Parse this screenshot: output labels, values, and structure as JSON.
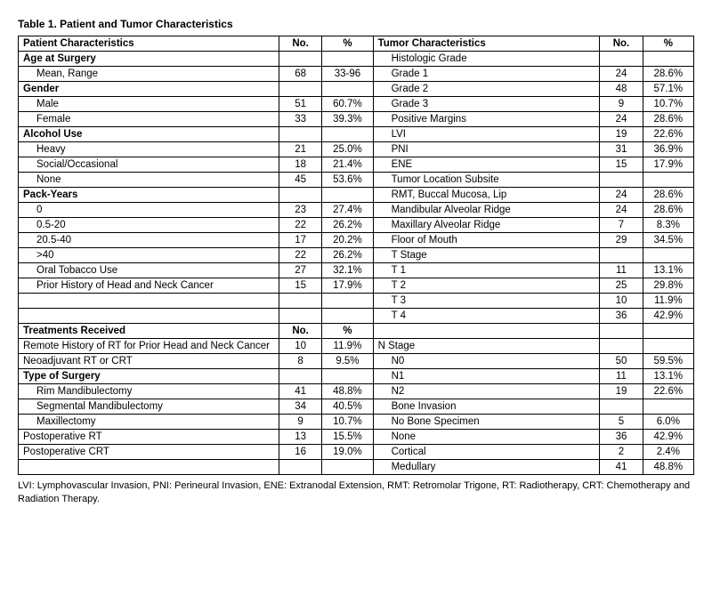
{
  "title": "Table 1. Patient and Tumor Characteristics",
  "headers": {
    "patient": "Patient Characteristics",
    "no": "No.",
    "pct": "%",
    "tumor": "Tumor Characteristics",
    "tno": "No.",
    "tpct": "%"
  },
  "rows": [
    {
      "type": "section",
      "left": "Age at Surgery",
      "right": "Histologic Grade"
    },
    {
      "type": "data",
      "left": "Mean, Range",
      "no": "68",
      "pct": "33-96",
      "right": "Grade 1",
      "tno": "24",
      "tpct": "28.6%"
    },
    {
      "type": "section",
      "left": "Gender",
      "right": "Grade 2",
      "tno": "48",
      "tpct": "57.1%"
    },
    {
      "type": "data",
      "left": "Male",
      "no": "51",
      "pct": "60.7%",
      "right": "Grade 3",
      "tno": "9",
      "tpct": "10.7%"
    },
    {
      "type": "data",
      "left": "Female",
      "no": "33",
      "pct": "39.3%",
      "right": "Positive Margins",
      "tno": "24",
      "tpct": "28.6%"
    },
    {
      "type": "section",
      "left": "Alcohol Use",
      "right": "LVI",
      "tno": "19",
      "tpct": "22.6%"
    },
    {
      "type": "data",
      "left": "Heavy",
      "no": "21",
      "pct": "25.0%",
      "right": "PNI",
      "tno": "31",
      "tpct": "36.9%"
    },
    {
      "type": "data",
      "left": "Social/Occasional",
      "no": "18",
      "pct": "21.4%",
      "right": "ENE",
      "tno": "15",
      "tpct": "17.9%"
    },
    {
      "type": "data",
      "left": "None",
      "no": "45",
      "pct": "53.6%",
      "right": "Tumor Location Subsite"
    },
    {
      "type": "section",
      "left": "Pack-Years",
      "right": "RMT, Buccal Mucosa, Lip",
      "tno": "24",
      "tpct": "28.6%"
    },
    {
      "type": "data",
      "left": "0",
      "no": "23",
      "pct": "27.4%",
      "right": "Mandibular Alveolar Ridge",
      "tno": "24",
      "tpct": "28.6%"
    },
    {
      "type": "data",
      "left": "0.5-20",
      "no": "22",
      "pct": "26.2%",
      "right": "Maxillary Alveolar Ridge",
      "tno": "7",
      "tpct": "8.3%"
    },
    {
      "type": "data",
      "left": "20.5-40",
      "no": "17",
      "pct": "20.2%",
      "right": "Floor of Mouth",
      "tno": "29",
      "tpct": "34.5%"
    },
    {
      "type": "data",
      "left": ">40",
      "no": "22",
      "pct": "26.2%",
      "right": "T Stage"
    },
    {
      "type": "data",
      "left": "Oral Tobacco Use",
      "no": "27",
      "pct": "32.1%",
      "right": "T 1",
      "tno": "11",
      "tpct": "13.1%"
    },
    {
      "type": "data",
      "left": "Prior History of Head and Neck Cancer",
      "no": "15",
      "pct": "17.9%",
      "right": "T 2",
      "tno": "25",
      "tpct": "29.8%"
    },
    {
      "type": "empty",
      "right": "T 3",
      "tno": "10",
      "tpct": "11.9%"
    },
    {
      "type": "empty2",
      "right": "T 4",
      "tno": "36",
      "tpct": "42.9%"
    },
    {
      "type": "treatments_header"
    },
    {
      "type": "treatment",
      "left": "Remote History of RT for Prior Head and Neck Cancer",
      "no": "10",
      "pct": "11.9%",
      "right": "N Stage"
    },
    {
      "type": "treatment",
      "left": "Neoadjuvant RT or CRT",
      "no": "8",
      "pct": "9.5%",
      "right": "N0",
      "tno": "50",
      "tpct": "59.5%"
    },
    {
      "type": "tsection",
      "left": "Type of Surgery",
      "right": "N1",
      "tno": "11",
      "tpct": "13.1%"
    },
    {
      "type": "tdata",
      "left": "Rim Mandibulectomy",
      "no": "41",
      "pct": "48.8%",
      "right": "N2",
      "tno": "19",
      "tpct": "22.6%"
    },
    {
      "type": "tdata",
      "left": "Segmental Mandibulectomy",
      "no": "34",
      "pct": "40.5%",
      "right": "Bone Invasion"
    },
    {
      "type": "tdata",
      "left": "Maxillectomy",
      "no": "9",
      "pct": "10.7%",
      "right": "No Bone Specimen",
      "tno": "5",
      "tpct": "6.0%"
    },
    {
      "type": "treatment",
      "left": "Postoperative RT",
      "no": "13",
      "pct": "15.5%",
      "right": "None",
      "tno": "36",
      "tpct": "42.9%"
    },
    {
      "type": "treatment",
      "left": "Postoperative CRT",
      "no": "16",
      "pct": "19.0%",
      "right": "Cortical",
      "tno": "2",
      "tpct": "2.4%"
    },
    {
      "type": "lastrow",
      "right": "Medullary",
      "tno": "41",
      "tpct": "48.8%"
    }
  ],
  "footnote": "LVI: Lymphovascular Invasion, PNI: Perineural Invasion, ENE: Extranodal Extension, RMT: Retromolar Trigone, RT: Radiotherapy, CRT: Chemotherapy and Radiation Therapy."
}
